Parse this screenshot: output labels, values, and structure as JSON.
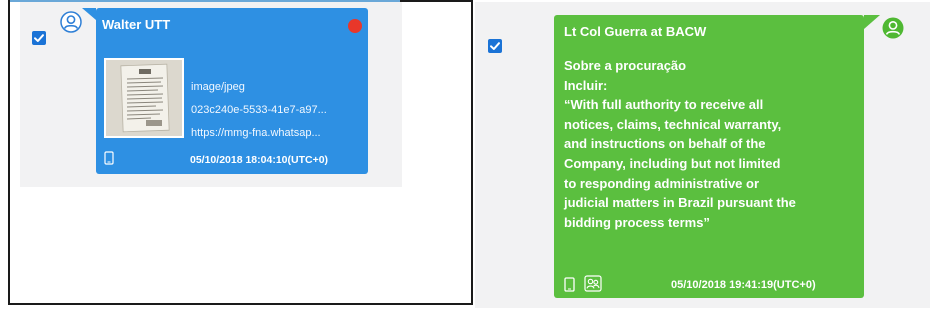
{
  "messages": [
    {
      "sender": "Walter UTT",
      "attachment": {
        "mime_type": "image/jpeg",
        "file_id": "023c240e-5533-41e7-a97...",
        "url": "https://mmg-fna.whatsap..."
      },
      "timestamp": "05/10/2018 18:04:10(UTC+0)",
      "selected": true,
      "status_dot_color": "#e8372a",
      "bubble_color": "#2e90e3"
    },
    {
      "sender": "Lt Col Guerra at BACW",
      "body": "Sobre a procuração\nIncluir:\n“With full authority to receive all\nnotices, claims, technical warranty,\nand instructions on behalf of the\nCompany, including but not limited\nto responding administrative or\njudicial matters in Brazil pursuant the\nbidding process terms”",
      "timestamp": "05/10/2018 19:41:19(UTC+0)",
      "selected": true,
      "bubble_color": "#5bbf3f"
    }
  ],
  "icons": {
    "checkbox": "checkmark-icon",
    "contact": "user-icon",
    "device": "phone-icon",
    "group": "group-icon"
  }
}
